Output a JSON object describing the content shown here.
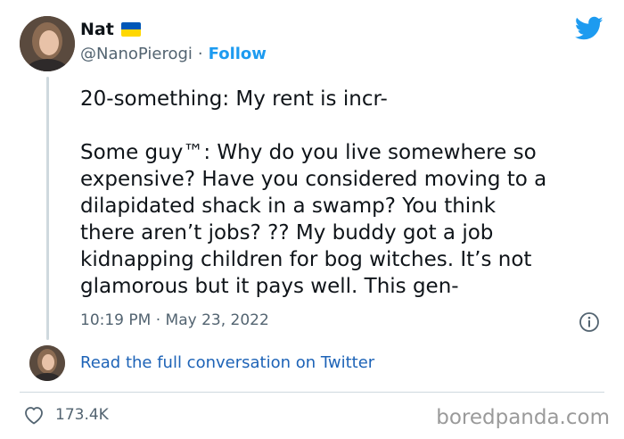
{
  "user": {
    "name": "Nat",
    "handle": "@NanoPierogi",
    "separator": "·",
    "follow_label": "Follow"
  },
  "tweet": {
    "text": "20-something: My rent is incr-\n\nSome guy™: Why do you live somewhere so\nexpensive? Have you considered moving to a\ndilapidated shack in a swamp? You think\nthere aren’t jobs? ?? My buddy got a job\nkidnapping children for bog witches. It’s not\nglamorous but it pays well. This gen-",
    "timestamp": "10:19 PM · May 23, 2022"
  },
  "conversation_link": "Read the full conversation on Twitter",
  "likes": "173.4K",
  "watermark": "boredpanda.com",
  "colors": {
    "twitter_blue": "#1d9bf0",
    "link_blue": "#1d63b7",
    "secondary_text": "#536471",
    "flag_blue": "#0057b7",
    "flag_yellow": "#ffd700"
  },
  "icons": [
    "ukraine-flag-icon",
    "twitter-bird-icon",
    "info-icon",
    "heart-icon"
  ]
}
